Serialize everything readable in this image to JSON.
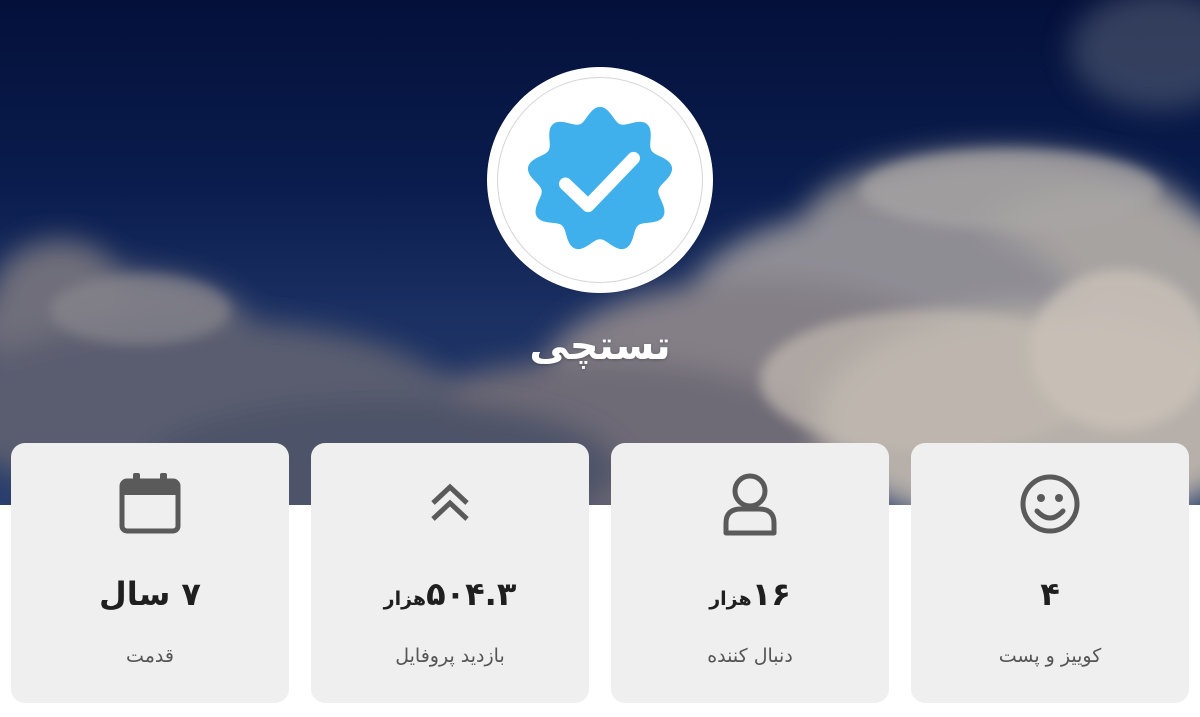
{
  "profile": {
    "name": "تستچی",
    "badge_icon": "verified-badge-icon",
    "badge_color": "#3fb0ec"
  },
  "stats": [
    {
      "icon": "calendar-icon",
      "value": "۷ سال",
      "unit": "",
      "label": "قدمت"
    },
    {
      "icon": "double-chevron-up-icon",
      "value": "۵۰۴.۳",
      "unit": "هزار",
      "label": "بازدید پروفایل"
    },
    {
      "icon": "user-icon",
      "value": "۱۶",
      "unit": "هزار",
      "label": "دنبال کننده"
    },
    {
      "icon": "smiley-icon",
      "value": "۴",
      "unit": "",
      "label": "کوییز و پست"
    }
  ]
}
